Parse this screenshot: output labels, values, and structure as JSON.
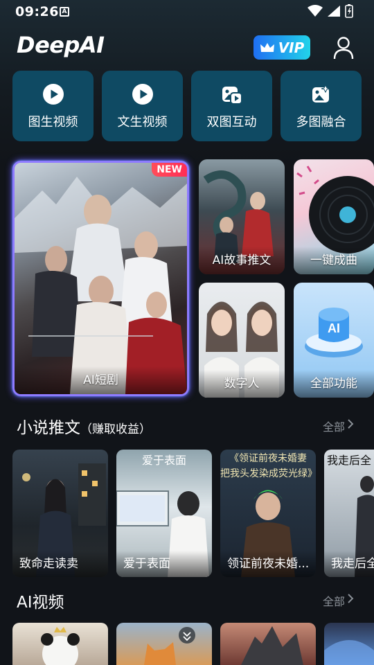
{
  "status_bar": {
    "time": "09:26",
    "notification_icon": "A"
  },
  "header": {
    "app_name": "DeepAI",
    "vip_label": "VIP"
  },
  "tools": [
    {
      "label": "图生视频",
      "icon": "play-circle-icon"
    },
    {
      "label": "文生视频",
      "icon": "play-circle-icon"
    },
    {
      "label": "双图互动",
      "icon": "dual-image-icon"
    },
    {
      "label": "多图融合",
      "icon": "multi-image-icon"
    }
  ],
  "features": {
    "big": {
      "label": "AI短剧",
      "badge": "NEW"
    },
    "items": [
      {
        "label": "AI故事推文"
      },
      {
        "label": "一键成曲"
      },
      {
        "label": "数字人"
      },
      {
        "label": "全部功能"
      }
    ]
  },
  "novel_section": {
    "title": "小说推文",
    "subtitle": "（赚取收益）",
    "more": "全部",
    "items": [
      {
        "caption": "致命走读卖"
      },
      {
        "caption": "爱于表面",
        "cover_title": "爱于表面"
      },
      {
        "caption": "领证前夜未婚...",
        "cover_title": "《领证前夜未婚妻",
        "cover_subtitle": "把我头发染成荧光绿》"
      },
      {
        "caption": "我走后全",
        "cover_title": "我走后全"
      }
    ]
  },
  "video_section": {
    "title": "AI视频",
    "more": "全部"
  },
  "colors": {
    "accent_blue": "#1f6ff2",
    "tool_bg": "#0f4a63",
    "background": "#111419",
    "new_badge": "#ff2d55"
  }
}
